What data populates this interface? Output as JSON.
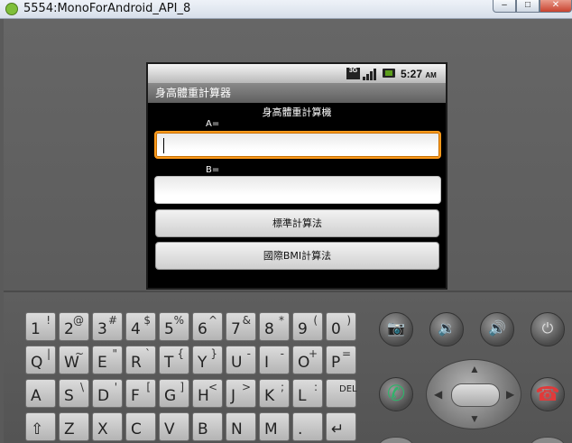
{
  "window": {
    "title": "5554:MonoForAndroid_API_8",
    "minimize": "–",
    "maximize": "□",
    "close": "✕"
  },
  "status_bar": {
    "network": "3G",
    "time": "5:27",
    "ampm": "AM"
  },
  "app": {
    "title": "身高體重計算器",
    "heading": "身高體重計算機",
    "label_a": "A=",
    "label_b": "B=",
    "input_a_value": "",
    "input_b_value": "",
    "button_standard": "標準計算法",
    "button_bmi": "國際BMI計算法"
  },
  "keyboard": {
    "row1": [
      {
        "m": "1",
        "a": "!"
      },
      {
        "m": "2",
        "a": "@"
      },
      {
        "m": "3",
        "a": "#"
      },
      {
        "m": "4",
        "a": "$"
      },
      {
        "m": "5",
        "a": "%"
      },
      {
        "m": "6",
        "a": "^"
      },
      {
        "m": "7",
        "a": "&"
      },
      {
        "m": "8",
        "a": "*"
      },
      {
        "m": "9",
        "a": "("
      },
      {
        "m": "0",
        "a": ")"
      }
    ],
    "row2": [
      {
        "m": "Q",
        "a": "|"
      },
      {
        "m": "W",
        "a": "~"
      },
      {
        "m": "E",
        "a": "\""
      },
      {
        "m": "R",
        "a": "`"
      },
      {
        "m": "T",
        "a": "{"
      },
      {
        "m": "Y",
        "a": "}"
      },
      {
        "m": "U",
        "a": "-"
      },
      {
        "m": "I",
        "a": "-"
      },
      {
        "m": "O",
        "a": "+"
      },
      {
        "m": "P",
        "a": "="
      }
    ],
    "row3": [
      {
        "m": "A",
        "a": ""
      },
      {
        "m": "S",
        "a": "\\"
      },
      {
        "m": "D",
        "a": "'"
      },
      {
        "m": "F",
        "a": "["
      },
      {
        "m": "G",
        "a": "]"
      },
      {
        "m": "H",
        "a": "<"
      },
      {
        "m": "J",
        "a": ">"
      },
      {
        "m": "K",
        "a": ";"
      },
      {
        "m": "L",
        "a": ":"
      },
      {
        "m": "DEL",
        "a": ""
      }
    ],
    "row4": [
      {
        "m": "⇧",
        "a": ""
      },
      {
        "m": "Z",
        "a": ""
      },
      {
        "m": "X",
        "a": ""
      },
      {
        "m": "C",
        "a": ""
      },
      {
        "m": "V",
        "a": ""
      },
      {
        "m": "B",
        "a": ""
      },
      {
        "m": "N",
        "a": ""
      },
      {
        "m": "M",
        "a": ""
      },
      {
        "m": ".",
        "a": ""
      },
      {
        "m": "↵",
        "a": ""
      }
    ]
  },
  "hardware_buttons": {
    "camera": "📷",
    "volume_down": "🔉",
    "volume_up": "🔊",
    "power": "⏻",
    "call": "✆",
    "end_call": "☎"
  },
  "colors": {
    "focus_border": "#ff9a1c",
    "title_bar": "#6f6f6f",
    "call_green": "#2fb36a",
    "end_red": "#e03a3a"
  }
}
